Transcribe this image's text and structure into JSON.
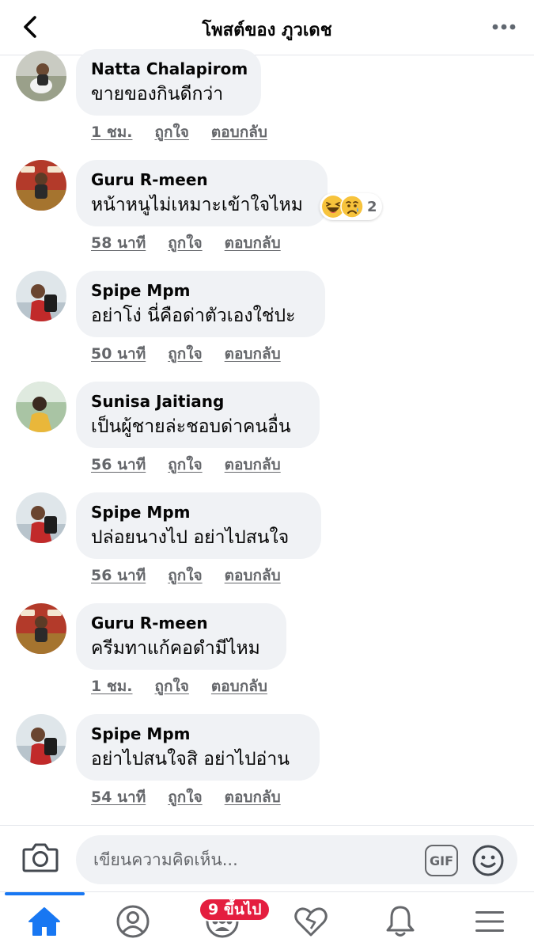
{
  "header": {
    "title": "โพสต์ของ ภูวเดช",
    "back_icon": "chevron-left-icon",
    "more_icon": "more-horizontal-icon"
  },
  "comments": [
    {
      "author": "Natta Chalapirom",
      "text": "ขายของกินดีกว่า",
      "time": "1 ชม.",
      "like": "ถูกใจ",
      "reply": "ตอบกลับ"
    },
    {
      "author": "Guru R-meen",
      "text": "หน้าหนูไม่เหมาะเข้าใจไหม",
      "time": "58 นาที",
      "like": "ถูกใจ",
      "reply": "ตอบกลับ",
      "reactions": {
        "icons": [
          "haha-reaction-icon",
          "sad-reaction-icon"
        ],
        "count": "2"
      }
    },
    {
      "author": "Spipe Mpm",
      "text": "อย่าโง่ นี่คือด่าตัวเองใช่ปะ",
      "time": "50 นาที",
      "like": "ถูกใจ",
      "reply": "ตอบกลับ"
    },
    {
      "author": "Sunisa Jaitiang",
      "text": "เป็นผู้ชายล่ะชอบด่าคนอื่น",
      "time": "56 นาที",
      "like": "ถูกใจ",
      "reply": "ตอบกลับ"
    },
    {
      "author": "Spipe Mpm",
      "text": "ปล่อยนางไป อย่าไปสนใจ",
      "time": "56 นาที",
      "like": "ถูกใจ",
      "reply": "ตอบกลับ"
    },
    {
      "author": "Guru R-meen",
      "text": "ครีมทาแก้คอดำมีไหม",
      "time": "1 ชม.",
      "like": "ถูกใจ",
      "reply": "ตอบกลับ"
    },
    {
      "author": "Spipe Mpm",
      "text": "อย่าไปสนใจสิ อย่าไปอ่าน",
      "time": "54 นาที",
      "like": "ถูกใจ",
      "reply": "ตอบกลับ"
    }
  ],
  "composer": {
    "placeholder": "เขียนความคิดเห็น...",
    "gif_label": "GIF",
    "camera_icon": "camera-icon",
    "emoji_icon": "emoji-smile-icon"
  },
  "tabbar": {
    "tabs": [
      {
        "icon": "home-icon",
        "active": true
      },
      {
        "icon": "profile-icon"
      },
      {
        "icon": "groups-icon"
      },
      {
        "icon": "dating-heart-icon"
      },
      {
        "icon": "bell-icon"
      },
      {
        "icon": "menu-icon"
      }
    ],
    "groups_badge": "9 ขึ้นไป"
  },
  "colors": {
    "accent": "#1877f2",
    "bubble": "#f0f2f5",
    "secondary_text": "#65676b",
    "badge": "#e41e3f"
  }
}
